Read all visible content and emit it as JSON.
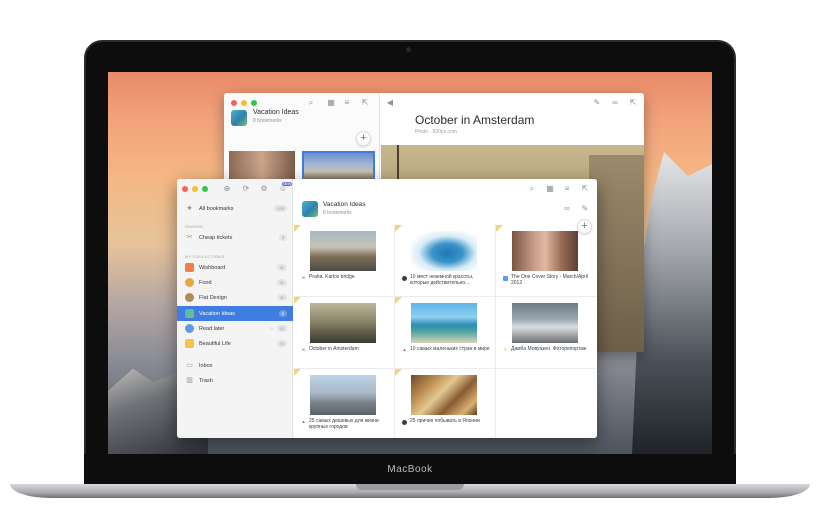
{
  "device": {
    "brand": "MacBook"
  },
  "back_window": {
    "collection_title": "Vacation Ideas",
    "collection_sub": "8 bookmarks",
    "article_title": "October in Amsterdam",
    "article_meta": "Photo  ·  500px.com",
    "add_label": "+"
  },
  "front_window": {
    "sidebar": {
      "all_bookmarks": {
        "label": "All bookmarks",
        "count": "129"
      },
      "shared_header": "SHARED",
      "shared": [
        {
          "label": "Cheap tickets",
          "count": "3"
        }
      ],
      "collections_header": "MY COLLECTIONS",
      "collections": [
        {
          "label": "Wishboard",
          "count": "11",
          "icon": "bookmark-icon",
          "color": "#f07f45"
        },
        {
          "label": "Food",
          "count": "11",
          "icon": "cupcake-icon",
          "color": "#e9a640"
        },
        {
          "label": "Flat Design",
          "count": "11",
          "icon": "planet-icon",
          "color": "#b38a56"
        },
        {
          "label": "Vacation Ideas",
          "count": "8",
          "icon": "map-icon",
          "color": "#4fb3c7"
        },
        {
          "label": "Read later",
          "count": "12",
          "icon": "clock-icon",
          "color": "#5b9be8"
        },
        {
          "label": "Beautiful Life",
          "count": "74",
          "icon": "folder-icon",
          "color": "#f3c542"
        }
      ],
      "inbox": "Inbox",
      "trash": "Trash",
      "badge": "NEW"
    },
    "collection_title": "Vacation Ideas",
    "collection_sub": "8 bookmarks",
    "add_label": "+",
    "cards": [
      {
        "caption": "Praha. Karlov bridge.",
        "icon": "link-icon"
      },
      {
        "caption": "10 мест неземной красоты, которые действительно...",
        "icon": "article-icon"
      },
      {
        "caption": "The One Cover Story - March/April 2012",
        "icon": "image-icon"
      },
      {
        "caption": "October in Amsterdam",
        "icon": "link-icon"
      },
      {
        "caption": "10 самых маленьких стран в мире",
        "icon": "article-icon"
      },
      {
        "caption": "Дамба Мовуазен. Фоторепортаж",
        "icon": "lightning-icon"
      },
      {
        "caption": "25 самых дешевых для жизни крупных городов",
        "icon": "article-icon"
      },
      {
        "caption": "25 причин побывать в Японии",
        "icon": "article-icon"
      }
    ]
  },
  "colors": {
    "accent": "#3f7ee0",
    "bookmark_corner": "#f0d57a"
  }
}
